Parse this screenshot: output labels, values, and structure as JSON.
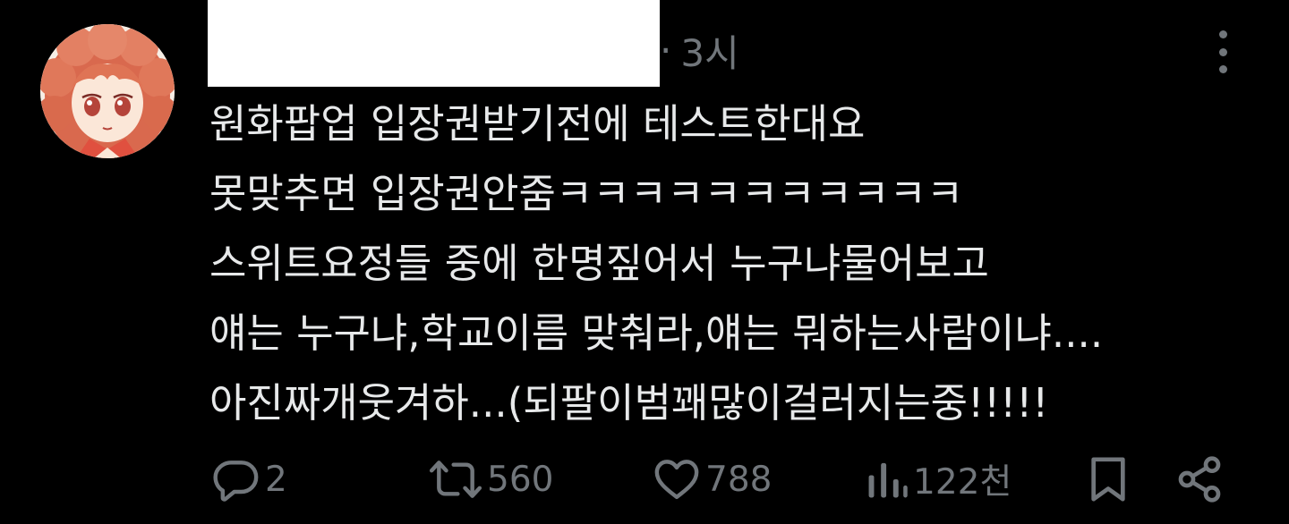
{
  "post": {
    "time": "3시",
    "time_separator": "·",
    "lines": [
      "원화팝업 입장권받기전에 테스트한대요",
      "못맞추면 입장권안줌ㅋㅋㅋㅋㅋㅋㅋㅋㅋㅋㅋ",
      "스위트요정들 중에 한명짚어서 누구냐물어보고",
      "얘는 누구냐,학교이름 맞춰라,얘는 뭐하는사람이냐....",
      "아진짜개웃겨하...(되팔이범꽤많이걸러지는중!!!!!"
    ]
  },
  "actions": {
    "reply": {
      "icon": "reply-icon",
      "count": "2"
    },
    "repost": {
      "icon": "repost-icon",
      "count": "560"
    },
    "like": {
      "icon": "heart-icon",
      "count": "788"
    },
    "views": {
      "icon": "views-icon",
      "count": "122천"
    },
    "bookmark": {
      "icon": "bookmark-icon"
    },
    "share": {
      "icon": "share-icon"
    }
  },
  "colors": {
    "background": "#000000",
    "text": "#e7e9ea",
    "muted": "#71767b",
    "redaction": "#ffffff"
  }
}
